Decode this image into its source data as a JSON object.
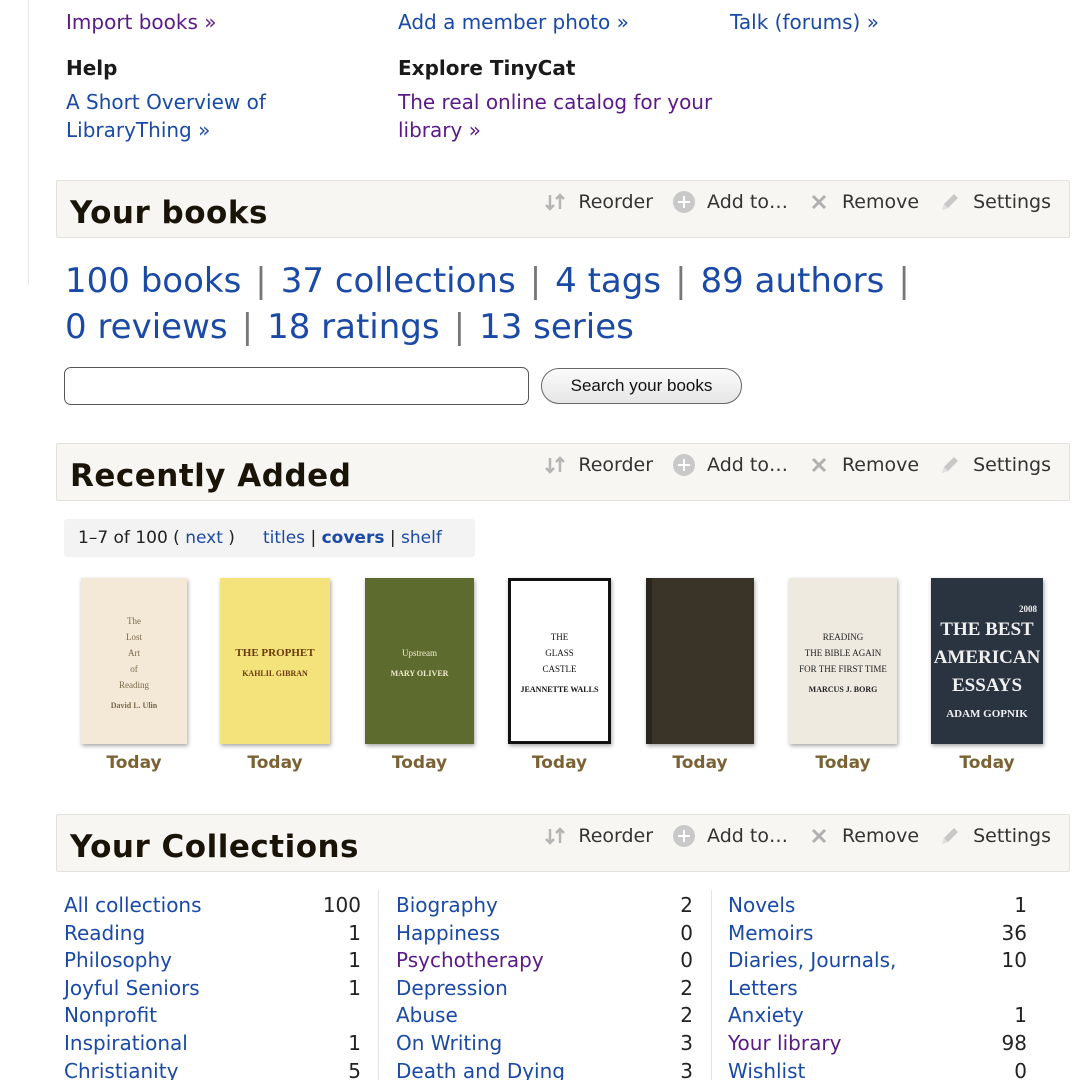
{
  "top_links": {
    "col1": {
      "link1": "Import books »",
      "heading": "Help",
      "link2": "A Short Overview of LibraryThing »"
    },
    "col2": {
      "link1": "Add a member photo »",
      "heading": "Explore TinyCat",
      "link2": "The real online catalog for your library »"
    },
    "col3": {
      "link1": "Talk (forums) »"
    }
  },
  "tools": {
    "reorder": "Reorder",
    "add_to": "Add to…",
    "remove": "Remove",
    "settings": "Settings"
  },
  "your_books": {
    "title": "Your books",
    "stats": [
      "100 books",
      "37 collections",
      "4 tags",
      "89 authors",
      "0 reviews",
      "18 ratings",
      "13 series"
    ],
    "search_button": "Search your books",
    "search_value": ""
  },
  "recently_added": {
    "title": "Recently Added",
    "range": "1–7 of 100 (",
    "next": "next",
    "close_paren": ")",
    "view_titles": "titles",
    "view_covers": "covers",
    "view_shelf": "shelf",
    "pipe": "|",
    "covers": [
      {
        "date": "Today",
        "lines": [
          "The",
          "Lost",
          "Art",
          "of",
          "Reading"
        ],
        "author": "David L. Ulin",
        "bg": "#f3e9d6",
        "fg": "#7a6a4a"
      },
      {
        "date": "Today",
        "lines": [
          "THE PROPHET"
        ],
        "author": "KAHLIL GIBRAN",
        "bg": "#f4e27a",
        "fg": "#6a3a10"
      },
      {
        "date": "Today",
        "lines": [
          "Upstream"
        ],
        "author": "MARY OLIVER",
        "bg": "#5d6b2e",
        "fg": "#f2ead0"
      },
      {
        "date": "Today",
        "lines": [
          "THE",
          "GLASS",
          "CASTLE"
        ],
        "author": "JEANNETTE WALLS",
        "bg": "#ffffff",
        "fg": "#111111"
      },
      {
        "date": "Today",
        "lines": [],
        "author": "",
        "bg": "#3a3428",
        "fg": "#3a3428"
      },
      {
        "date": "Today",
        "lines": [
          "READING",
          "THE BIBLE AGAIN",
          "FOR THE FIRST TIME"
        ],
        "author": "MARCUS J. BORG",
        "bg": "#eeeae0",
        "fg": "#222222"
      },
      {
        "date": "Today",
        "lines": [
          "2008",
          "THE BEST",
          "AMERICAN",
          "ESSAYS"
        ],
        "author": "ADAM GOPNIK",
        "bg": "#2a3340",
        "fg": "#f0f0f0"
      }
    ]
  },
  "collections": {
    "title": "Your Collections",
    "col1": [
      {
        "name": "All collections",
        "count": "100"
      },
      {
        "name": "Reading",
        "count": "1"
      },
      {
        "name": "Philosophy",
        "count": "1"
      },
      {
        "name": "Joyful Seniors",
        "count": "1"
      },
      {
        "name": "Nonprofit",
        "count": ""
      },
      {
        "name": "Inspirational",
        "count": "1"
      },
      {
        "name": "Christianity",
        "count": "5"
      }
    ],
    "col2": [
      {
        "name": "Biography",
        "count": "2"
      },
      {
        "name": "Happiness",
        "count": "0"
      },
      {
        "name": "Psychotherapy",
        "count": "0"
      },
      {
        "name": "Depression",
        "count": "2"
      },
      {
        "name": "Abuse",
        "count": "2"
      },
      {
        "name": "On Writing",
        "count": "3"
      },
      {
        "name": "Death and Dying",
        "count": "3"
      }
    ],
    "col3": [
      {
        "name": "Novels",
        "count": "1"
      },
      {
        "name": "Memoirs",
        "count": "36"
      },
      {
        "name": "Diaries, Journals,",
        "count": "10"
      },
      {
        "name": "Letters",
        "count": ""
      },
      {
        "name": "Anxiety",
        "count": "1"
      },
      {
        "name": "Your library",
        "count": "98"
      },
      {
        "name": "Wishlist",
        "count": "0"
      }
    ]
  }
}
